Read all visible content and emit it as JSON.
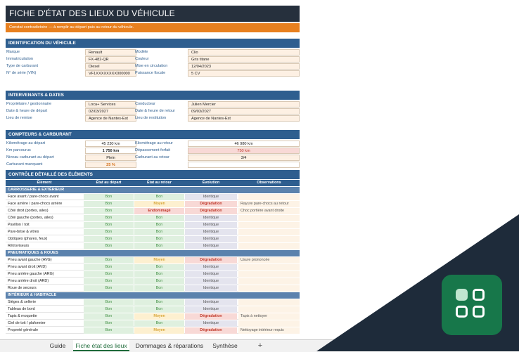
{
  "sheet": {
    "title": "FICHE D'ÉTAT DES LIEUX DU VÉHICULE",
    "subtitle": "Constat contradictoire — à remplir au départ puis au retour du véhicule."
  },
  "identification": {
    "header": "IDENTIFICATION DU VÉHICULE",
    "rows": [
      {
        "k1": "Marque",
        "v1": "Renault",
        "k2": "Modèle",
        "v2": "Clio"
      },
      {
        "k1": "Immatriculation",
        "v1": "FX-482-QR",
        "k2": "Couleur",
        "v2": "Gris titane"
      },
      {
        "k1": "Type de carburant",
        "v1": "Diesel",
        "k2": "Mise en circulation",
        "v2": "12/04/2023"
      },
      {
        "k1": "N° de série (VIN)",
        "v1": "VF1XXXXXXXX000000",
        "k2": "Puissance fiscale",
        "v2": "5 CV"
      }
    ]
  },
  "intervenants": {
    "header": "INTERVENANTS & DATES",
    "rows": [
      {
        "k1": "Propriétaire / gestionnaire",
        "v1": "Loca+ Services",
        "k2": "Conducteur",
        "v2": "Julien Mercier"
      },
      {
        "k1": "Date & heure de départ",
        "v1": "02/03/2027",
        "k2": "Date & heure de retour",
        "v2": "09/03/2027"
      },
      {
        "k1": "Lieu de remise",
        "v1": "Agence de Nantes-Est",
        "k2": "Lieu de restitution",
        "v2": "Agence de Nantes-Est"
      }
    ]
  },
  "compteurs": {
    "header": "COMPTEURS & CARBURANT",
    "rows": [
      {
        "k1": "Kilométrage au départ",
        "v1": "45 230 km",
        "k2": "Kilométrage au retour",
        "v2": "46 980 km"
      },
      {
        "k1": "Km parcourus",
        "v1": "1 750 km",
        "k2": "Dépassement forfait",
        "v2": "750 km"
      },
      {
        "k1": "Niveau carburant au départ",
        "v1": "Plein",
        "k2": "Carburant au retour",
        "v2": "3/4"
      },
      {
        "k1": "Carburant manquant",
        "v1": "25 %",
        "k2": "",
        "v2": ""
      }
    ]
  },
  "controle": {
    "header": "CONTRÔLE DÉTAILLÉ DES ÉLÉMENTS",
    "columns": [
      "Élément",
      "État au départ",
      "État au retour",
      "Évolution",
      "Observations"
    ],
    "categories": [
      {
        "name": "CARROSSERIE & EXTÉRIEUR",
        "items": [
          {
            "el": "Face avant / pare-chocs avant",
            "dep": "Bon",
            "ret": "Bon",
            "evo": "Identique",
            "obs": ""
          },
          {
            "el": "Face arrière / pare-chocs arrière",
            "dep": "Bon",
            "ret": "Moyen",
            "evo": "Dégradation",
            "obs": "Rayure pare-chocs au retour"
          },
          {
            "el": "Côté droit (portes, ailes)",
            "dep": "Bon",
            "ret": "Endommagé",
            "evo": "Dégradation",
            "obs": "Choc portière avant droite"
          },
          {
            "el": "Côté gauche (portes, ailes)",
            "dep": "Bon",
            "ret": "Bon",
            "evo": "Identique",
            "obs": ""
          },
          {
            "el": "Pavillon / toit",
            "dep": "Bon",
            "ret": "Bon",
            "evo": "Identique",
            "obs": ""
          },
          {
            "el": "Pare-brise & vitres",
            "dep": "Bon",
            "ret": "Bon",
            "evo": "Identique",
            "obs": ""
          },
          {
            "el": "Optiques (phares, feux)",
            "dep": "Bon",
            "ret": "Bon",
            "evo": "Identique",
            "obs": ""
          },
          {
            "el": "Rétroviseurs",
            "dep": "Bon",
            "ret": "Bon",
            "evo": "Identique",
            "obs": ""
          }
        ]
      },
      {
        "name": "PNEUMATIQUES & ROUES",
        "items": [
          {
            "el": "Pneu avant gauche (AVG)",
            "dep": "Bon",
            "ret": "Moyen",
            "evo": "Dégradation",
            "obs": "Usure prononcée"
          },
          {
            "el": "Pneu avant droit (AVD)",
            "dep": "Bon",
            "ret": "Bon",
            "evo": "Identique",
            "obs": ""
          },
          {
            "el": "Pneu arrière gauche (ARG)",
            "dep": "Bon",
            "ret": "Bon",
            "evo": "Identique",
            "obs": ""
          },
          {
            "el": "Pneu arrière droit (ARD)",
            "dep": "Bon",
            "ret": "Bon",
            "evo": "Identique",
            "obs": ""
          },
          {
            "el": "Roue de secours",
            "dep": "Bon",
            "ret": "Bon",
            "evo": "Identique",
            "obs": ""
          }
        ]
      },
      {
        "name": "INTÉRIEUR & HABITACLE",
        "items": [
          {
            "el": "Sièges & sellerie",
            "dep": "Bon",
            "ret": "Bon",
            "evo": "Identique",
            "obs": ""
          },
          {
            "el": "Tableau de bord",
            "dep": "Bon",
            "ret": "Bon",
            "evo": "Identique",
            "obs": ""
          },
          {
            "el": "Tapis & moquette",
            "dep": "Bon",
            "ret": "Moyen",
            "evo": "Dégradation",
            "obs": "Tapis à nettoyer"
          },
          {
            "el": "Ciel de toit / plafonnier",
            "dep": "Bon",
            "ret": "Bon",
            "evo": "Identique",
            "obs": ""
          },
          {
            "el": "Propreté générale",
            "dep": "Bon",
            "ret": "Moyen",
            "evo": "Dégradation",
            "obs": "Nettoyage intérieur requis"
          }
        ]
      }
    ]
  },
  "tabs": [
    "Guide",
    "Fiche état des lieux",
    "Dommages & réparations",
    "Synthèse"
  ],
  "tab_add": "+",
  "active_tab": "Fiche état des lieux",
  "colors": {
    "accent": "#17774a",
    "header": "#2e5e8f",
    "title": "#26303d",
    "orange": "#e8801f"
  }
}
